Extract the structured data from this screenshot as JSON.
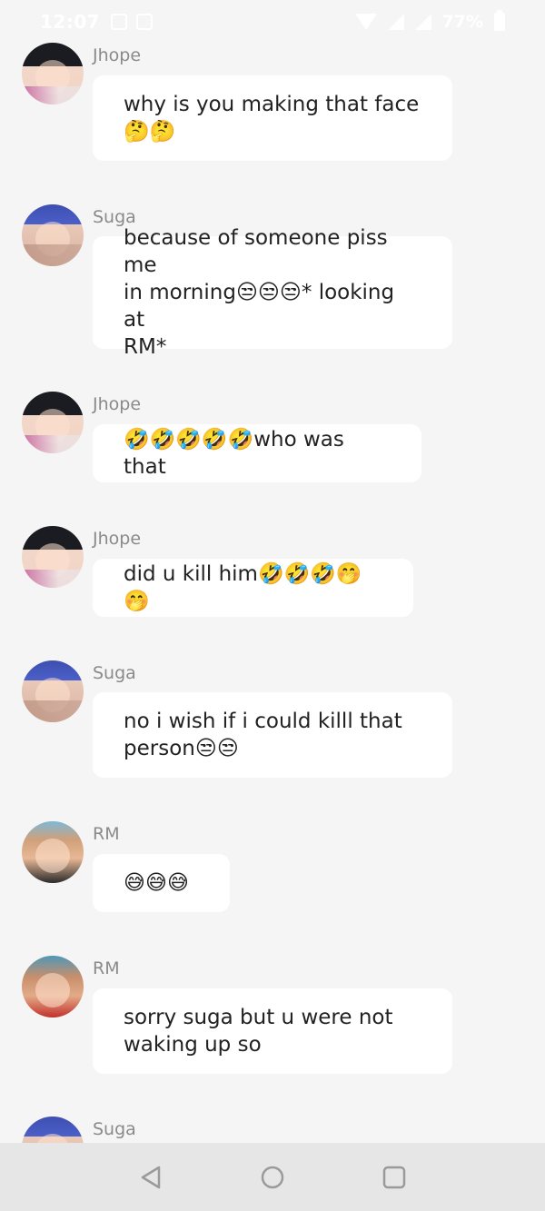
{
  "status_bar": {
    "time": "12:07",
    "battery": "77%",
    "icons": [
      "image-icon",
      "screen-icon",
      "wifi-icon",
      "signal-icon",
      "signal-icon",
      "battery-icon"
    ]
  },
  "messages": [
    {
      "sender": "Jhope",
      "avatar": "jhope-avatar",
      "lines": [
        "why is you making that face",
        "🤔🤔"
      ]
    },
    {
      "sender": "Suga",
      "avatar": "suga-avatar",
      "lines": [
        "because of someone piss me",
        "in morning😒😒😒* looking at",
        "RM*"
      ]
    },
    {
      "sender": "Jhope",
      "avatar": "jhope-avatar",
      "lines": [
        "🤣🤣🤣🤣🤣who was that"
      ]
    },
    {
      "sender": "Jhope",
      "avatar": "jhope-avatar",
      "lines": [
        "did u kill him🤣🤣🤣🤭🤭"
      ]
    },
    {
      "sender": "Suga",
      "avatar": "suga-avatar",
      "lines": [
        "no i wish if i could killl that",
        "person😒😒"
      ]
    },
    {
      "sender": "RM",
      "avatar": "rm-avatar",
      "lines": [
        "😅😅😅"
      ]
    },
    {
      "sender": "RM",
      "avatar": "rm-avatar",
      "lines": [
        "sorry suga but u were not",
        "waking up so"
      ]
    },
    {
      "sender": "Suga",
      "avatar": "suga-avatar",
      "lines": []
    }
  ],
  "nav_bar": {
    "buttons": [
      "back-icon",
      "home-icon",
      "recents-icon"
    ]
  },
  "colors": {
    "background": "#f5f5f5",
    "bubble": "#ffffff",
    "sender_name": "#8a8a8a",
    "nav_bar": "#e6e6e6"
  }
}
